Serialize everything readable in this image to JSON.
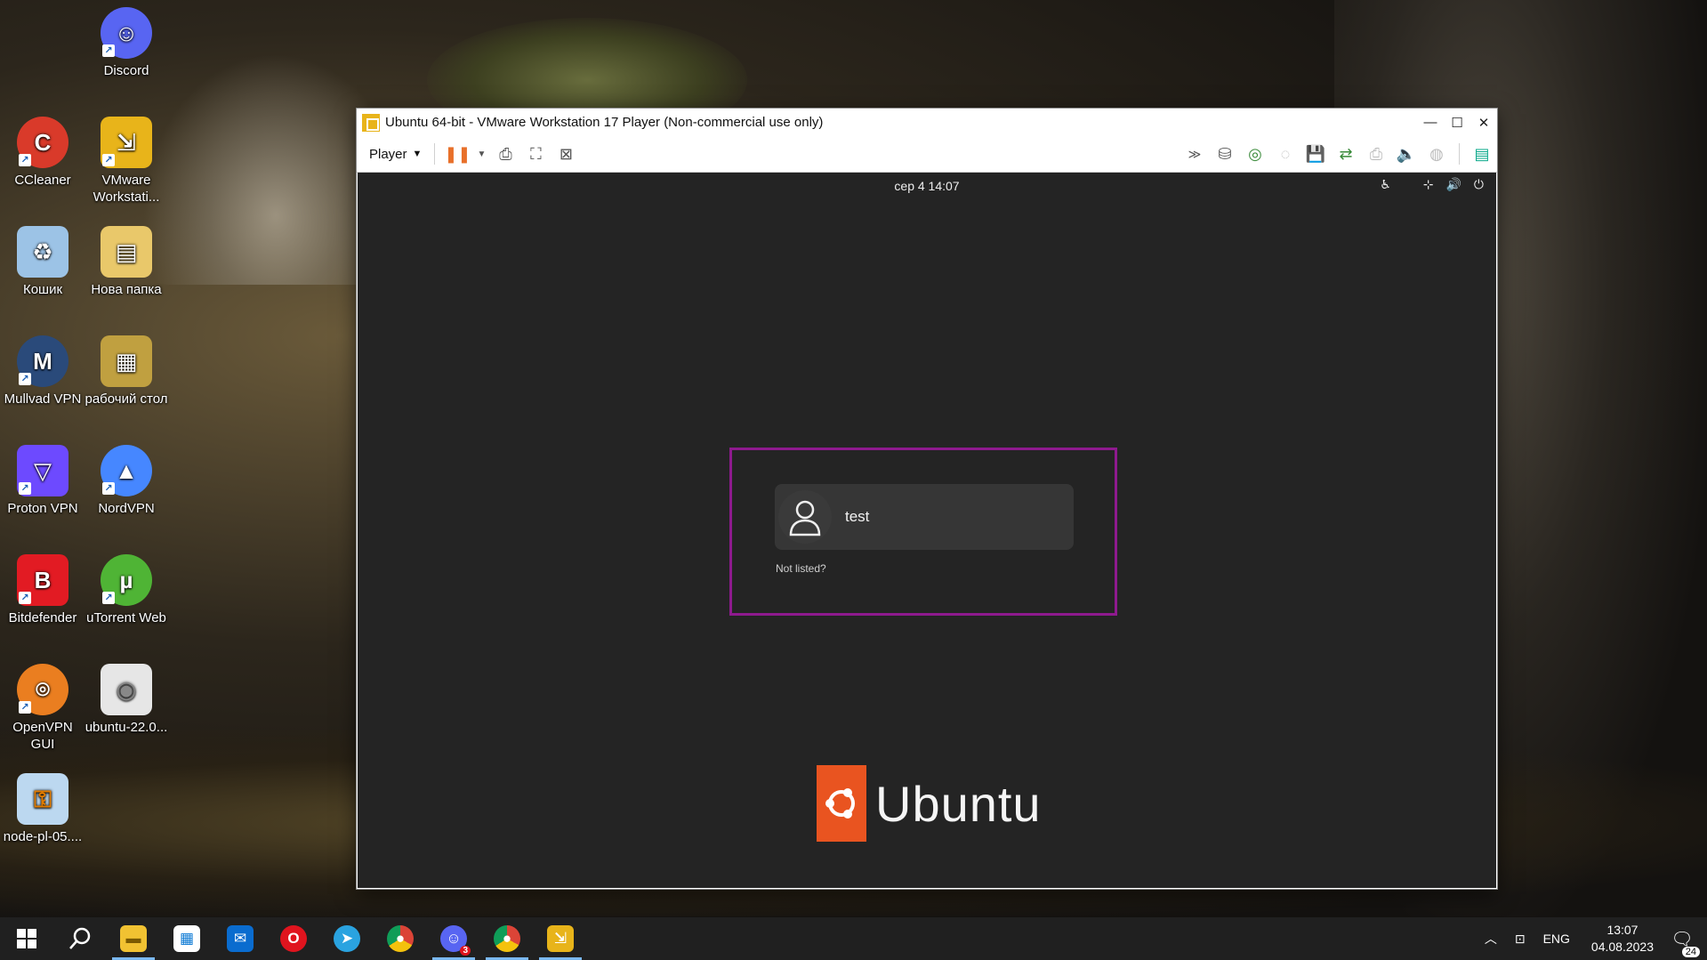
{
  "desktop": {
    "icons": [
      {
        "label": "Discord",
        "color": "#5865f2",
        "glyph": "D",
        "left": 0,
        "top": 0
      },
      {
        "label": "CCleaner",
        "color": "#d93a2a",
        "glyph": "C"
      },
      {
        "label": "VMware Workstati...",
        "color": "#e8b41a",
        "glyph": "V"
      },
      {
        "label": "Кошик",
        "color": "#7aa7d6",
        "glyph": "♻"
      },
      {
        "label": "Нова папка",
        "color": "#e9c86a",
        "glyph": "▮"
      },
      {
        "label": "Mullvad VPN",
        "color": "#2a4a7a",
        "glyph": "M"
      },
      {
        "label": "рабочий стол",
        "color": "#c0a040",
        "glyph": "▦"
      },
      {
        "label": "Proton VPN",
        "color": "#6d4aff",
        "glyph": "▽"
      },
      {
        "label": "NordVPN",
        "color": "#4687ff",
        "glyph": "N"
      },
      {
        "label": "Bitdefender",
        "color": "#e21b23",
        "glyph": "B"
      },
      {
        "label": "uTorrent Web",
        "color": "#4fb435",
        "glyph": "µ"
      },
      {
        "label": "OpenVPN GUI",
        "color": "#ea7e20",
        "glyph": "O"
      },
      {
        "label": "ubuntu-22.0...",
        "color": "#dadada",
        "glyph": "◉"
      },
      {
        "label": "node-pl-05....",
        "color": "#5aa0d8",
        "glyph": "🔑"
      }
    ]
  },
  "vm": {
    "title": "Ubuntu 64-bit - VMware Workstation 17 Player (Non-commercial use only)",
    "player_label": "Player",
    "guest": {
      "clock": "сер 4  14:07",
      "user_name": "test",
      "not_listed": "Not listed?",
      "brand": "Ubuntu"
    }
  },
  "taskbar": {
    "lang": "ENG",
    "time": "13:07",
    "date": "04.08.2023",
    "notifications": "24",
    "discord_badge": "3"
  },
  "colors": {
    "ubuntu_orange": "#e95420",
    "login_frame": "#8e1a8e",
    "guest_bg": "#242424"
  }
}
